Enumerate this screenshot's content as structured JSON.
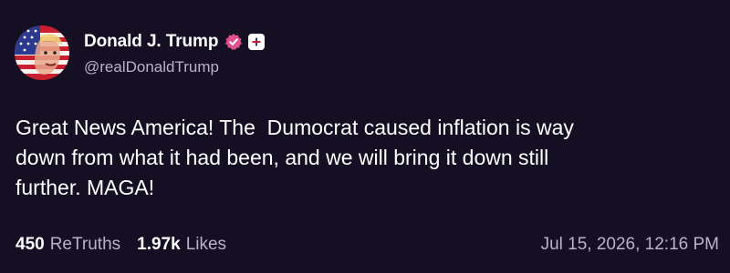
{
  "author": {
    "display_name": "Donald J. Trump",
    "handle": "@realDonaldTrump",
    "avatar_icon": "flag-portrait-avatar",
    "verified_icon": "verified-badge-icon",
    "plus_icon": "plus-badge-icon"
  },
  "post": {
    "text": "Great News America! The  Dumocrat caused inflation is way\ndown from what it had been, and we will bring it down still\nfurther. MAGA!"
  },
  "stats": {
    "retruths_count": "450",
    "retruths_label": "ReTruths",
    "likes_count": "1.97k",
    "likes_label": "Likes"
  },
  "timestamp": "Jul 15, 2026, 12:16 PM",
  "colors": {
    "background": "#150f24",
    "verified": "#e0508c",
    "muted_text": "#b9b3c9"
  }
}
